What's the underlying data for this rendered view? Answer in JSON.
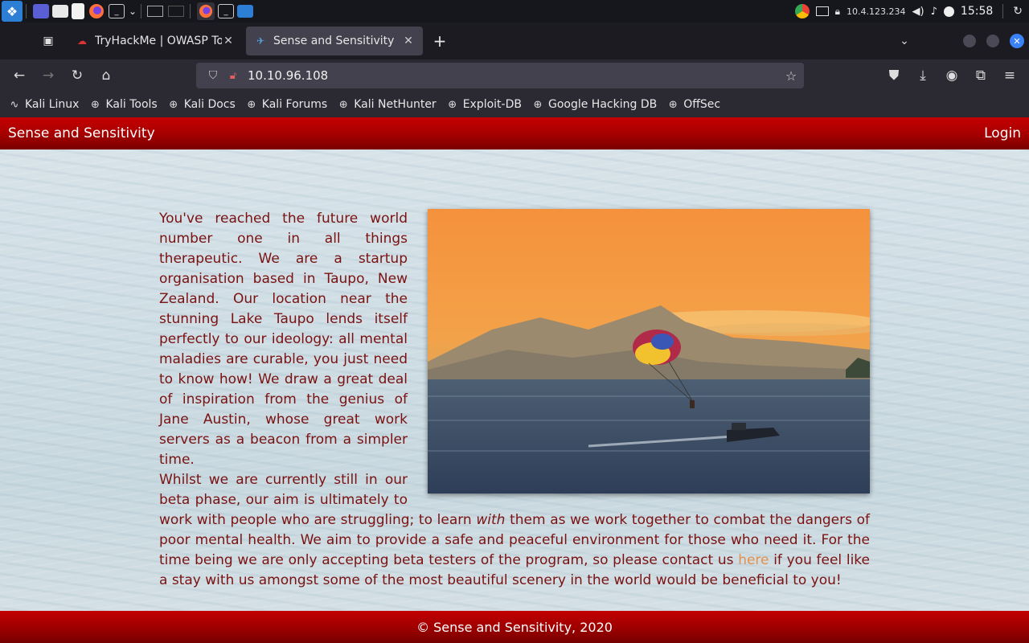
{
  "taskbar": {
    "ip": "10.4.123.234",
    "clock": "15:58"
  },
  "tabs": [
    {
      "title": "TryHackMe | OWASP Top",
      "active": false
    },
    {
      "title": "Sense and Sensitivity",
      "active": true
    }
  ],
  "navbar": {
    "url": "10.10.96.108"
  },
  "bookmarks": [
    {
      "label": "Kali Linux",
      "icon": "kali-dragon-icon"
    },
    {
      "label": "Kali Tools",
      "icon": "globe-icon"
    },
    {
      "label": "Kali Docs",
      "icon": "globe-icon"
    },
    {
      "label": "Kali Forums",
      "icon": "globe-icon"
    },
    {
      "label": "Kali NetHunter",
      "icon": "globe-icon"
    },
    {
      "label": "Exploit-DB",
      "icon": "globe-icon"
    },
    {
      "label": "Google Hacking DB",
      "icon": "globe-icon"
    },
    {
      "label": "OffSec",
      "icon": "globe-icon"
    }
  ],
  "site": {
    "brand": "Sense and Sensitivity",
    "login": "Login",
    "paragraph1": "You've reached the future world number one in all things therapeutic. We are a startup organisation based in Taupo, New Zealand. Our location near the stunning Lake Taupo lends itself perfectly to our ideology: all mental maladies are curable, you just need to know how! We draw a great deal of inspiration from the genius of Jane Austin, whose great work servers as a beacon from a simpler time.",
    "paragraph2_before_with": "Whilst we are currently still in our beta phase, our aim is ultimately to work with people who are struggling; to learn ",
    "paragraph2_with": "with",
    "paragraph2_after_with": " them as we work together to combat the dangers of poor mental health. We aim to provide a safe and peaceful environment for those who need it. For the time being we are only accepting beta testers of the program, so please contact us ",
    "contact_link": "here",
    "paragraph2_end": " if you feel like a stay with us amongst some of the most beautiful scenery in the world would be beneficial to you!",
    "footer": "© Sense and Sensitivity, 2020"
  },
  "colors": {
    "header_red": "#a80000",
    "text_red": "#7a1212",
    "link_orange": "#e2904e"
  }
}
